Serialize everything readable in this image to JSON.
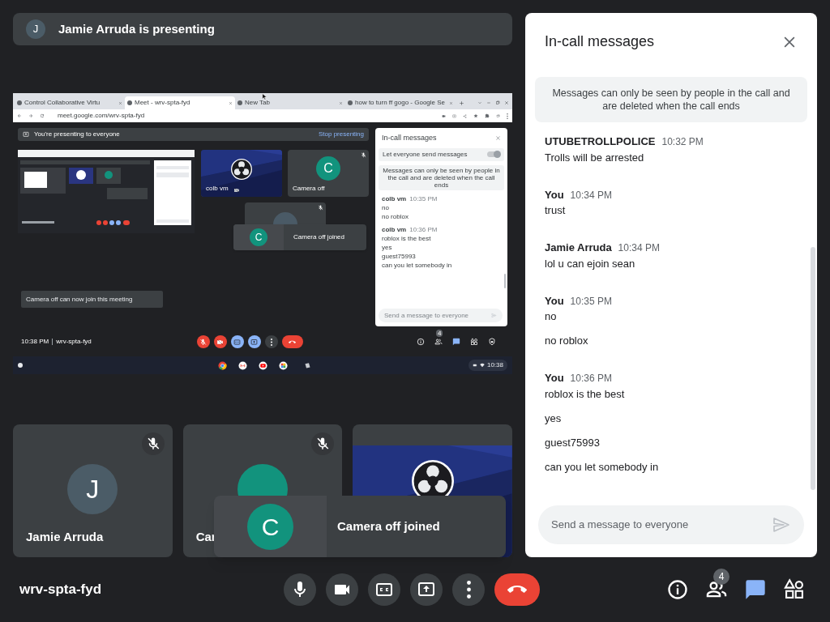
{
  "presenter_banner": {
    "initial": "J",
    "text": "Jamie Arruda is presenting"
  },
  "shared_screen": {
    "browser_tabs": [
      {
        "title": "Control Collaborative Virtu",
        "selected": false
      },
      {
        "title": "Meet - wrv-spta-fyd",
        "selected": true
      },
      {
        "title": "New Tab",
        "selected": false
      },
      {
        "title": "how to turn ff gogo - Google Se",
        "selected": false
      }
    ],
    "url": "meet.google.com/wrv-spta-fyd",
    "presenting_banner": {
      "text": "You're presenting to everyone",
      "action": "Stop presenting"
    },
    "tiles": [
      {
        "kind": "video",
        "name": "colb vm"
      },
      {
        "kind": "avatar",
        "initial": "C",
        "name": "Camera off",
        "muted": true
      },
      {
        "kind": "avatar",
        "muted": true
      }
    ],
    "notification": {
      "initial": "C",
      "text": "Camera off joined"
    },
    "toast": "Camera off can now join this meeting",
    "time": "10:38 PM",
    "meeting_code": "wrv-spta-fyd",
    "controls": [
      {
        "kind": "mic",
        "off": true
      },
      {
        "kind": "camera",
        "off": true
      },
      {
        "kind": "captions",
        "active": true
      },
      {
        "kind": "present",
        "active": true
      },
      {
        "kind": "more"
      },
      {
        "kind": "end_call"
      }
    ],
    "side_buttons": [
      {
        "kind": "info",
        "selected": false
      },
      {
        "kind": "people",
        "badge": "4",
        "selected": false
      },
      {
        "kind": "chat",
        "selected": true
      },
      {
        "kind": "activities",
        "selected": false
      },
      {
        "kind": "host",
        "selected": false
      }
    ],
    "chat": {
      "title": "In-call messages",
      "toggle": {
        "label": "Let everyone send messages",
        "on": true
      },
      "notice": "Messages can only be seen by people in the call and are deleted when the call ends",
      "groups": [
        {
          "sender": "colb vm",
          "time": "10:35 PM",
          "messages": [
            "no",
            "no roblox"
          ]
        },
        {
          "sender": "colb vm",
          "time": "10:36 PM",
          "messages": [
            "roblox is the best",
            "yes",
            "guest75993",
            "can you let somebody in"
          ]
        }
      ],
      "placeholder": "Send a message to everyone"
    },
    "shelf_time": "10:38"
  },
  "tiles": [
    {
      "kind": "avatar",
      "initial": "J",
      "name": "Jamie Arruda",
      "muted": true
    },
    {
      "kind": "avatar",
      "name": "Car",
      "muted": true
    },
    {
      "kind": "video"
    }
  ],
  "notification": {
    "initial": "C",
    "text": "Camera off joined"
  },
  "meeting_code": "wrv-spta-fyd",
  "controls": [
    {
      "kind": "mic",
      "off": false
    },
    {
      "kind": "camera",
      "off": false
    },
    {
      "kind": "captions",
      "active": false
    },
    {
      "kind": "present",
      "active": false
    },
    {
      "kind": "more"
    },
    {
      "kind": "end_call"
    }
  ],
  "side_buttons": [
    {
      "kind": "info",
      "selected": false
    },
    {
      "kind": "people",
      "badge": "4",
      "selected": false
    },
    {
      "kind": "chat",
      "selected": true
    },
    {
      "kind": "activities",
      "selected": false
    }
  ],
  "chat": {
    "title": "In-call messages",
    "notice": "Messages can only be seen by people in the call and are deleted when the call ends",
    "groups": [
      {
        "sender": "UTUBETROLLPOLICE",
        "time": "10:32 PM",
        "messages": [
          "Trolls will be arrested"
        ]
      },
      {
        "sender": "You",
        "time": "10:34 PM",
        "messages": [
          "trust"
        ]
      },
      {
        "sender": "Jamie Arruda",
        "time": "10:34 PM",
        "messages": [
          "lol u can ejoin sean"
        ]
      },
      {
        "sender": "You",
        "time": "10:35 PM",
        "messages": [
          "no",
          "no roblox"
        ]
      },
      {
        "sender": "You",
        "time": "10:36 PM",
        "messages": [
          "roblox is the best",
          "yes",
          "guest75993",
          "can you let somebody in"
        ]
      }
    ],
    "placeholder": "Send a message to everyone"
  }
}
